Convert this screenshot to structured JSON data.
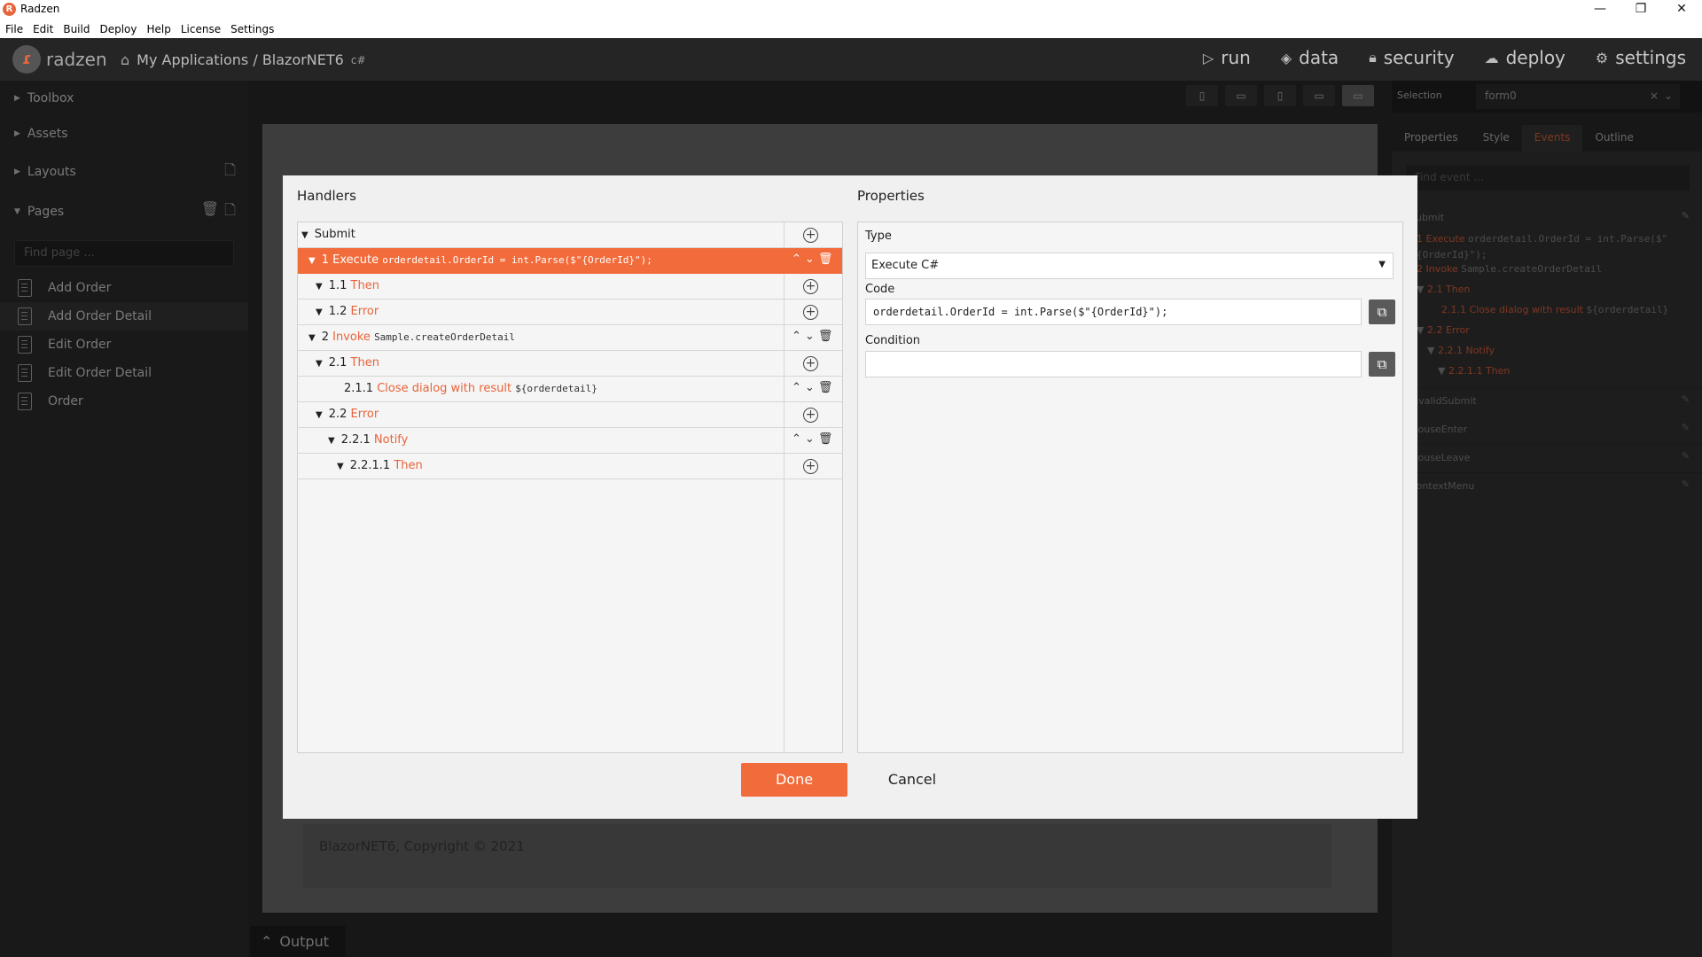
{
  "window": {
    "title": "Radzen",
    "logo": "R",
    "minimize": "—",
    "maximize": "❐",
    "close": "✕"
  },
  "menu": [
    "File",
    "Edit",
    "Build",
    "Deploy",
    "Help",
    "License",
    "Settings"
  ],
  "header": {
    "brand": "radzen",
    "breadcrumb": "My Applications / BlazorNET6",
    "project_badge": "c#",
    "nav": [
      {
        "label": "run",
        "icon": "play-icon"
      },
      {
        "label": "data",
        "icon": "layers-icon"
      },
      {
        "label": "security",
        "icon": "lock-icon"
      },
      {
        "label": "deploy",
        "icon": "cloud-icon"
      },
      {
        "label": "settings",
        "icon": "gear-icon"
      }
    ]
  },
  "sidebar": {
    "toolbox": "Toolbox",
    "assets": "Assets",
    "layouts": "Layouts",
    "pages": "Pages",
    "find_placeholder": "Find page ...",
    "items": [
      "Add Order",
      "Add Order Detail",
      "Edit Order",
      "Edit Order Detail",
      "Order"
    ],
    "selected_index": 1
  },
  "canvas": {
    "copyright": "BlazorNET6, Copyright © 2021"
  },
  "right_panel": {
    "selection_label": "Selection",
    "selection_value": "form0",
    "tabs": [
      "Properties",
      "Style",
      "Events",
      "Outline"
    ],
    "active_tab": "Events",
    "find_placeholder": "Find event ...",
    "event_submit": "Submit",
    "tree": {
      "line1_num": "1",
      "line1_kw": "Execute",
      "line1_code": "orderdetail.OrderId = int.Parse($\"",
      "line1_code2": "{OrderId}\");",
      "line2_num": "2",
      "line2_kw": "Invoke",
      "line2_code": "Sample.createOrderDetail",
      "l21_num": "2.1",
      "l21_kw": "Then",
      "l211_num": "2.1.1",
      "l211_kw": "Close dialog with result",
      "l211_code": "${orderdetail}",
      "l22_num": "2.2",
      "l22_kw": "Error",
      "l221_num": "2.2.1",
      "l221_kw": "Notify",
      "l2211_num": "2.2.1.1",
      "l2211_kw": "Then"
    },
    "events": [
      "InvalidSubmit",
      "MouseEnter",
      "MouseLeave",
      "ContextMenu"
    ]
  },
  "output": {
    "label": "Output"
  },
  "dialog": {
    "handlers_title": "Handlers",
    "properties_title": "Properties",
    "rows": {
      "submit": "Submit",
      "r1_num": "1",
      "r1_kw": "Execute",
      "r1_code": "orderdetail.OrderId = int.Parse($\"{OrderId}\");",
      "r11_num": "1.1",
      "r11_kw": "Then",
      "r12_num": "1.2",
      "r12_kw": "Error",
      "r2_num": "2",
      "r2_kw": "Invoke",
      "r2_code": "Sample.createOrderDetail",
      "r21_num": "2.1",
      "r21_kw": "Then",
      "r211_num": "2.1.1",
      "r211_kw": "Close dialog with result",
      "r211_code": "${orderdetail}",
      "r22_num": "2.2",
      "r22_kw": "Error",
      "r221_num": "2.2.1",
      "r221_kw": "Notify",
      "r2211_num": "2.2.1.1",
      "r2211_kw": "Then"
    },
    "type_label": "Type",
    "type_value": "Execute C#",
    "code_label": "Code",
    "code_value": "orderdetail.OrderId = int.Parse($\"{OrderId}\");",
    "condition_label": "Condition",
    "condition_value": "",
    "done": "Done",
    "cancel": "Cancel"
  },
  "colors": {
    "accent": "#f26b3a",
    "dark_bg": "#2b2b2b"
  }
}
